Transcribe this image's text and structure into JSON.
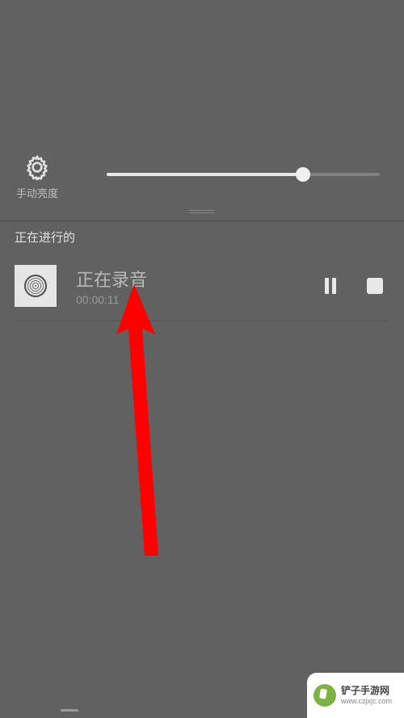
{
  "brightness": {
    "label": "手动亮度",
    "value_percent": 72
  },
  "section": {
    "header": "正在进行的"
  },
  "notification": {
    "title": "正在录音",
    "time": "00:00:11"
  },
  "watermark": {
    "line1": "铲子手游网",
    "line2": "www.czjxjc.com"
  }
}
